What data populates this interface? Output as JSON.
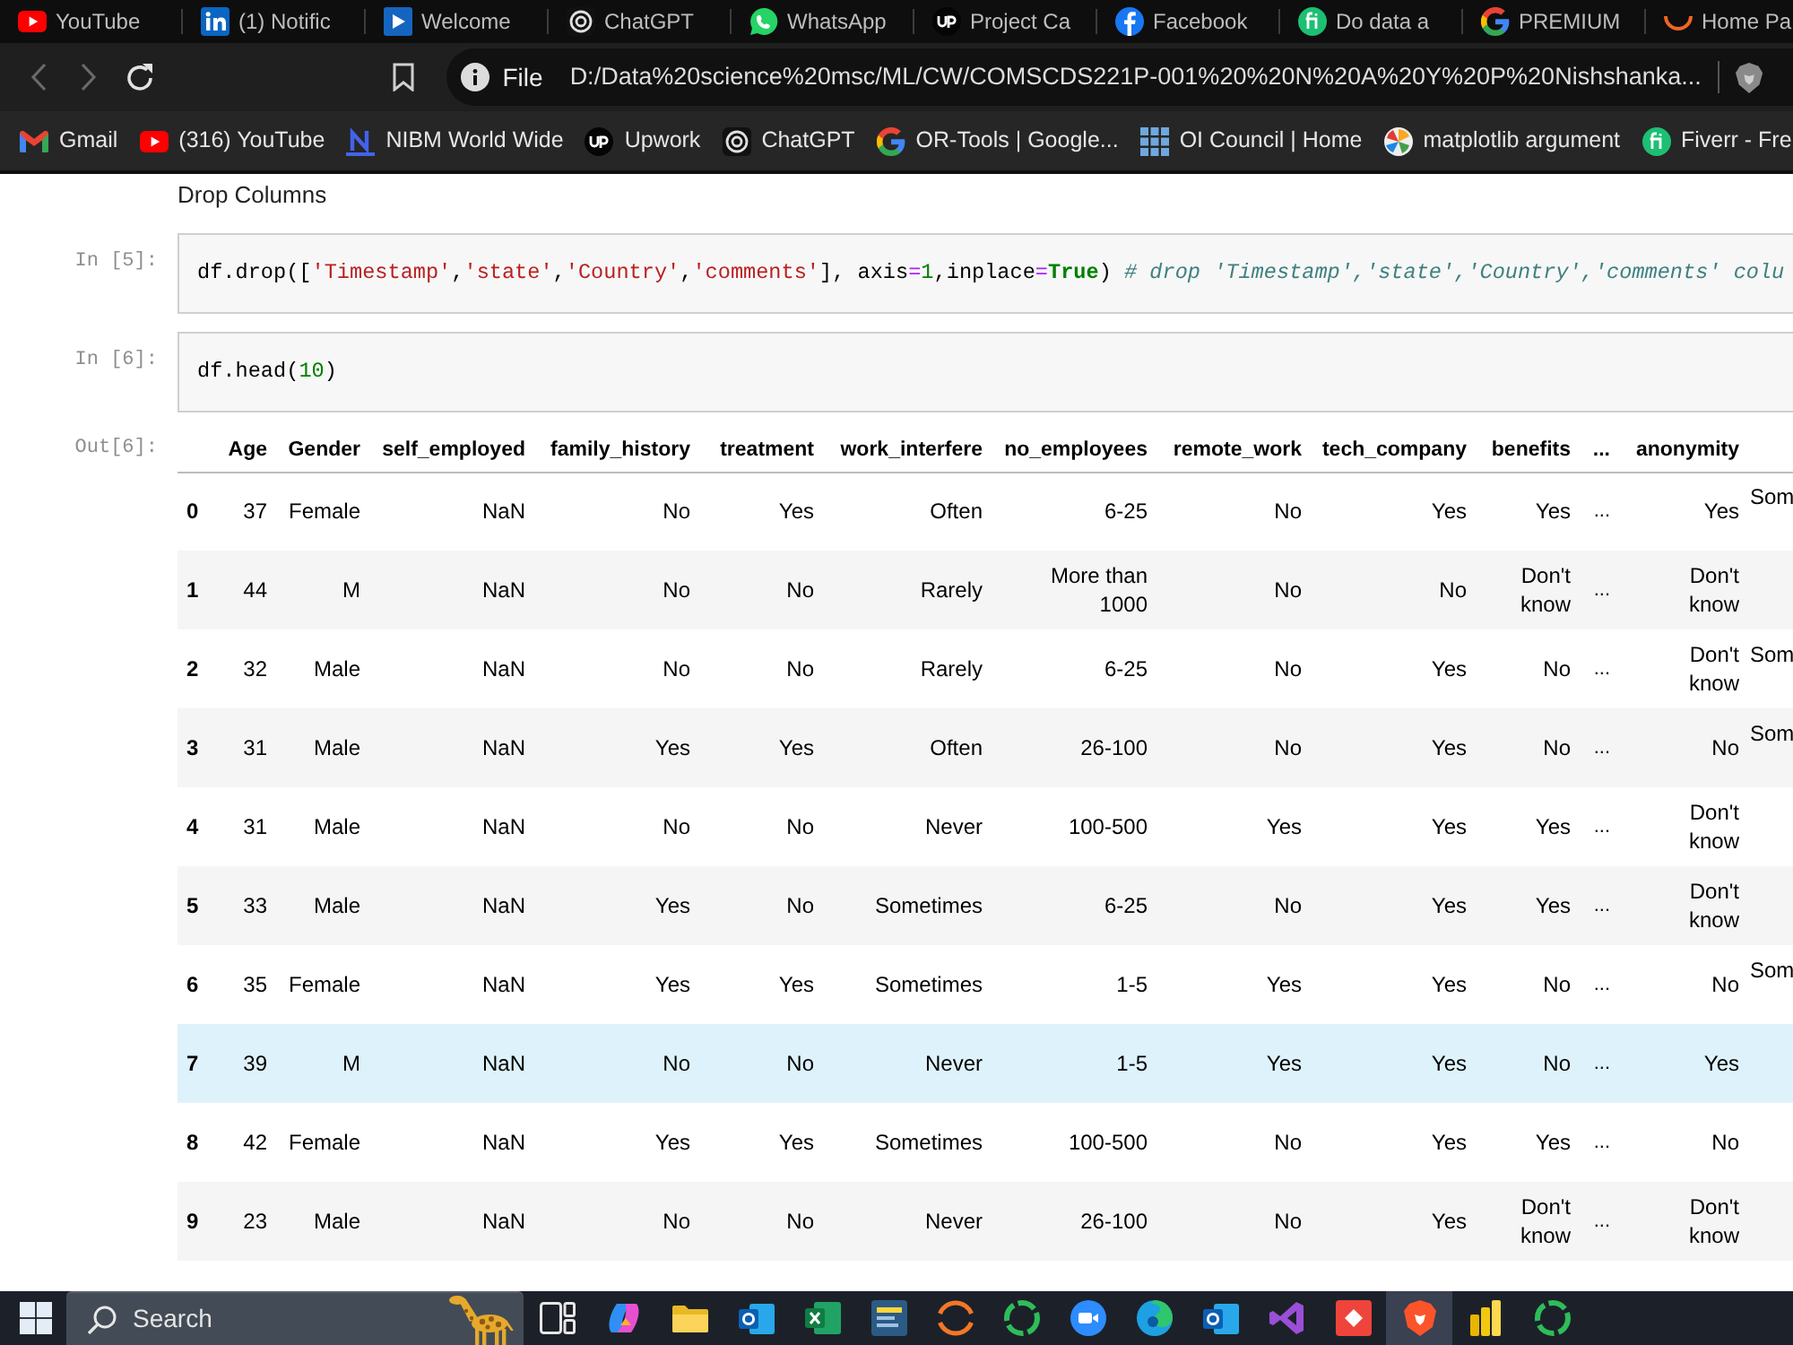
{
  "tabs": [
    {
      "kind": "youtube",
      "title": "YouTube"
    },
    {
      "kind": "linkedin",
      "title": "(1) Notific"
    },
    {
      "kind": "slides",
      "title": "Welcome"
    },
    {
      "kind": "chatgpt",
      "title": "ChatGPT"
    },
    {
      "kind": "whatsapp",
      "title": "WhatsApp"
    },
    {
      "kind": "upwork",
      "title": "Project Ca"
    },
    {
      "kind": "facebook",
      "title": "Facebook"
    },
    {
      "kind": "fiverr",
      "title": "Do data a"
    },
    {
      "kind": "google",
      "title": "PREMIUM"
    },
    {
      "kind": "arc",
      "title": "Home Pa"
    }
  ],
  "toolbar": {
    "nav_buttons": [
      {
        "kind": "back",
        "disabled": true
      },
      {
        "kind": "forward",
        "disabled": true
      },
      {
        "kind": "reload",
        "disabled": false
      }
    ],
    "address": {
      "label": "File",
      "url": "D:/Data%20science%20msc/ML/CW/COMSCDS221P-001%20%20N%20A%20Y%20P%20Nishshanka..."
    }
  },
  "bookmarks": [
    {
      "kind": "gmail",
      "title": "Gmail"
    },
    {
      "kind": "youtube",
      "title": "(316) YouTube"
    },
    {
      "kind": "nibm",
      "title": "NIBM World Wide"
    },
    {
      "kind": "upwork",
      "title": "Upwork"
    },
    {
      "kind": "chatgpt",
      "title": "ChatGPT"
    },
    {
      "kind": "google",
      "title": "OR-Tools | Google..."
    },
    {
      "kind": "grid",
      "title": "OI Council | Home"
    },
    {
      "kind": "wheel",
      "title": "matplotlib argument"
    },
    {
      "kind": "fiverr",
      "title": "Fiverr - Fre"
    }
  ],
  "notebook": {
    "cells": [
      {
        "kind": "markdown",
        "text": "Drop Columns"
      },
      {
        "kind": "code",
        "prompt": "In [5]:",
        "tokens": [
          {
            "kind": "name",
            "text": "df"
          },
          {
            "kind": "punct",
            "text": "."
          },
          {
            "kind": "name",
            "text": "drop"
          },
          {
            "kind": "punct",
            "text": "(["
          },
          {
            "kind": "string",
            "text": "'Timestamp'"
          },
          {
            "kind": "punct",
            "text": ","
          },
          {
            "kind": "string",
            "text": "'state'"
          },
          {
            "kind": "punct",
            "text": ","
          },
          {
            "kind": "string",
            "text": "'Country'"
          },
          {
            "kind": "punct",
            "text": ","
          },
          {
            "kind": "string",
            "text": "'comments'"
          },
          {
            "kind": "punct",
            "text": "], "
          },
          {
            "kind": "name",
            "text": "axis"
          },
          {
            "kind": "op",
            "text": "="
          },
          {
            "kind": "number",
            "text": "1"
          },
          {
            "kind": "punct",
            "text": ","
          },
          {
            "kind": "name",
            "text": "inplace"
          },
          {
            "kind": "op",
            "text": "="
          },
          {
            "kind": "keyword",
            "text": "True"
          },
          {
            "kind": "punct",
            "text": ") "
          },
          {
            "kind": "comment",
            "text": "# drop 'Timestamp','state','Country','comments' colu"
          }
        ]
      },
      {
        "kind": "code",
        "prompt": "In [6]:",
        "tokens": [
          {
            "kind": "name",
            "text": "df"
          },
          {
            "kind": "punct",
            "text": "."
          },
          {
            "kind": "name",
            "text": "head"
          },
          {
            "kind": "punct",
            "text": "("
          },
          {
            "kind": "number",
            "text": "10"
          },
          {
            "kind": "punct",
            "text": ")"
          }
        ]
      },
      {
        "kind": "output",
        "prompt": "Out[6]:",
        "table": {
          "columns": [
            {
              "label": "Age",
              "kind": "data"
            },
            {
              "label": "Gender",
              "kind": "data"
            },
            {
              "label": "self_employed",
              "kind": "data"
            },
            {
              "label": "family_history",
              "kind": "data"
            },
            {
              "label": "treatment",
              "kind": "data"
            },
            {
              "label": "work_interfere",
              "kind": "data"
            },
            {
              "label": "no_employees",
              "kind": "data"
            },
            {
              "label": "remote_work",
              "kind": "data"
            },
            {
              "label": "tech_company",
              "kind": "data"
            },
            {
              "label": "benefits",
              "kind": "data"
            },
            {
              "label": "...",
              "kind": "ellipsis"
            },
            {
              "label": "anonymity",
              "kind": "data"
            }
          ],
          "rows": [
            {
              "index": "0",
              "cells": [
                "37",
                "Female",
                "NaN",
                "No",
                "Yes",
                "Often",
                "6-25",
                "No",
                "Yes",
                "Yes",
                "...",
                "Yes"
              ],
              "column_13": "Som",
              "highlighted": false
            },
            {
              "index": "1",
              "cells": [
                "44",
                "M",
                "NaN",
                "No",
                "No",
                "Rarely",
                "More than 1000",
                "No",
                "No",
                "Don't know",
                "...",
                "Don't know"
              ],
              "highlighted": false
            },
            {
              "index": "2",
              "cells": [
                "32",
                "Male",
                "NaN",
                "No",
                "No",
                "Rarely",
                "6-25",
                "No",
                "Yes",
                "No",
                "...",
                "Don't know"
              ],
              "column_13": "Som",
              "highlighted": false
            },
            {
              "index": "3",
              "cells": [
                "31",
                "Male",
                "NaN",
                "Yes",
                "Yes",
                "Often",
                "26-100",
                "No",
                "Yes",
                "No",
                "...",
                "No"
              ],
              "column_13": "Som",
              "highlighted": false
            },
            {
              "index": "4",
              "cells": [
                "31",
                "Male",
                "NaN",
                "No",
                "No",
                "Never",
                "100-500",
                "Yes",
                "Yes",
                "Yes",
                "...",
                "Don't know"
              ],
              "highlighted": false
            },
            {
              "index": "5",
              "cells": [
                "33",
                "Male",
                "NaN",
                "Yes",
                "No",
                "Sometimes",
                "6-25",
                "No",
                "Yes",
                "Yes",
                "...",
                "Don't know"
              ],
              "highlighted": false
            },
            {
              "index": "6",
              "cells": [
                "35",
                "Female",
                "NaN",
                "Yes",
                "Yes",
                "Sometimes",
                "1-5",
                "Yes",
                "Yes",
                "No",
                "...",
                "No"
              ],
              "column_13": "Som",
              "highlighted": false
            },
            {
              "index": "7",
              "cells": [
                "39",
                "M",
                "NaN",
                "No",
                "No",
                "Never",
                "1-5",
                "Yes",
                "Yes",
                "No",
                "...",
                "Yes"
              ],
              "highlighted": true
            },
            {
              "index": "8",
              "cells": [
                "42",
                "Female",
                "NaN",
                "Yes",
                "Yes",
                "Sometimes",
                "100-500",
                "No",
                "Yes",
                "Yes",
                "...",
                "No"
              ],
              "highlighted": false
            },
            {
              "index": "9",
              "cells": [
                "23",
                "Male",
                "NaN",
                "No",
                "No",
                "Never",
                "26-100",
                "No",
                "Yes",
                "Don't know",
                "...",
                "Don't know"
              ],
              "highlighted": false
            }
          ]
        }
      }
    ]
  },
  "taskbar": {
    "search": {
      "placeholder": "Search"
    },
    "apps": [
      {
        "kind": "taskview",
        "active": false
      },
      {
        "kind": "copilot",
        "active": false
      },
      {
        "kind": "explorer",
        "active": false
      },
      {
        "kind": "outlook",
        "active": false
      },
      {
        "kind": "excel",
        "active": false
      },
      {
        "kind": "ide",
        "active": false
      },
      {
        "kind": "arcs",
        "active": false
      },
      {
        "kind": "ring",
        "active": false
      },
      {
        "kind": "zoom",
        "active": false
      },
      {
        "kind": "edge",
        "active": false
      },
      {
        "kind": "outlook",
        "active": false
      },
      {
        "kind": "vs",
        "active": false
      },
      {
        "kind": "anydesk",
        "active": false
      },
      {
        "kind": "brave",
        "active": true
      },
      {
        "kind": "powerbi",
        "active": false
      },
      {
        "kind": "ring",
        "active": false
      }
    ]
  }
}
